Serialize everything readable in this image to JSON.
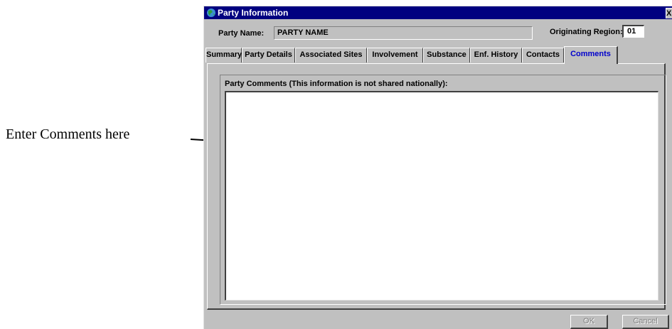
{
  "annotation": {
    "text": "Enter Comments here"
  },
  "window": {
    "title": "Party Information",
    "close_label": "X"
  },
  "header": {
    "party_name_label": "Party Name:",
    "party_name_value": "PARTY NAME",
    "region_label": "Originating Region:",
    "region_value": "01"
  },
  "tabs": [
    {
      "label": "Summary"
    },
    {
      "label": "Party Details"
    },
    {
      "label": "Associated Sites"
    },
    {
      "label": "Involvement"
    },
    {
      "label": "Substance"
    },
    {
      "label": "Enf. History"
    },
    {
      "label": "Contacts"
    },
    {
      "label": "Comments",
      "active": true
    }
  ],
  "comments": {
    "group_label": "Party Comments (This information is not shared nationally):",
    "value": ""
  },
  "buttons": {
    "ok_label": "OK",
    "cancel_label": "Cancel"
  },
  "colors": {
    "titlebar": "#000080",
    "active_tab_text": "#0000cc",
    "window_bg": "#c0c0c0"
  }
}
